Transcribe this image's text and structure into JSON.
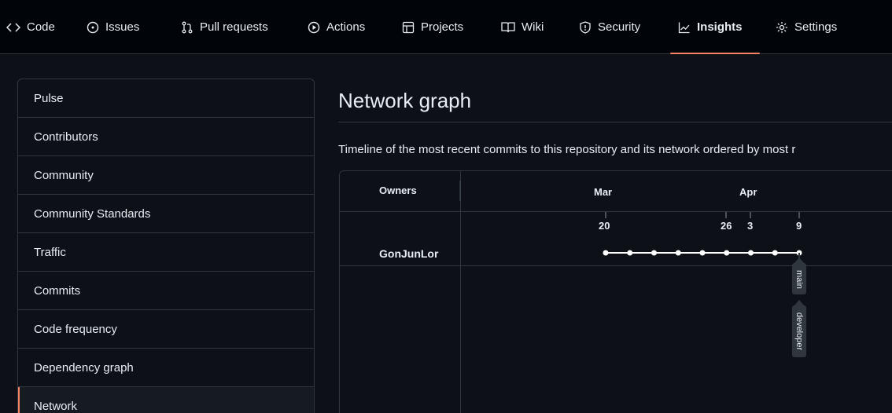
{
  "nav": {
    "tabs": [
      {
        "label": "Code",
        "icon": "code-icon"
      },
      {
        "label": "Issues",
        "icon": "issue-icon"
      },
      {
        "label": "Pull requests",
        "icon": "pull-request-icon"
      },
      {
        "label": "Actions",
        "icon": "play-icon"
      },
      {
        "label": "Projects",
        "icon": "table-icon"
      },
      {
        "label": "Wiki",
        "icon": "book-icon"
      },
      {
        "label": "Security",
        "icon": "shield-icon"
      },
      {
        "label": "Insights",
        "icon": "graph-icon",
        "active": true
      },
      {
        "label": "Settings",
        "icon": "gear-icon"
      }
    ]
  },
  "sidebar": {
    "items": [
      {
        "label": "Pulse"
      },
      {
        "label": "Contributors"
      },
      {
        "label": "Community"
      },
      {
        "label": "Community Standards"
      },
      {
        "label": "Traffic"
      },
      {
        "label": "Commits"
      },
      {
        "label": "Code frequency"
      },
      {
        "label": "Dependency graph"
      },
      {
        "label": "Network",
        "selected": true
      }
    ]
  },
  "content": {
    "title": "Network graph",
    "description": "Timeline of the most recent commits to this repository and its network ordered by most r"
  },
  "graph": {
    "owners_header": "Owners",
    "months": [
      "Mar",
      "Apr"
    ],
    "days": [
      "20",
      "26",
      "3",
      "9"
    ],
    "owner": "GonJunLor",
    "branches": [
      "main",
      "developer"
    ],
    "commit_count": 9,
    "colors": {
      "accent": "#f78166",
      "line": "#ffffff",
      "label_bg": "#30363d"
    }
  }
}
